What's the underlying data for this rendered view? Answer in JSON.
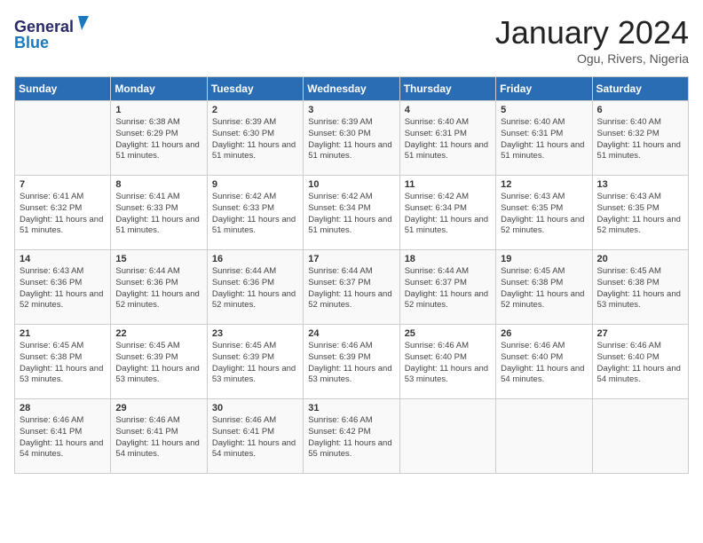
{
  "header": {
    "logo_line1": "General",
    "logo_line2": "Blue",
    "month_title": "January 2024",
    "location": "Ogu, Rivers, Nigeria"
  },
  "days_of_week": [
    "Sunday",
    "Monday",
    "Tuesday",
    "Wednesday",
    "Thursday",
    "Friday",
    "Saturday"
  ],
  "weeks": [
    [
      {
        "day": "",
        "sunrise": "",
        "sunset": "",
        "daylight": ""
      },
      {
        "day": "1",
        "sunrise": "Sunrise: 6:38 AM",
        "sunset": "Sunset: 6:29 PM",
        "daylight": "Daylight: 11 hours and 51 minutes."
      },
      {
        "day": "2",
        "sunrise": "Sunrise: 6:39 AM",
        "sunset": "Sunset: 6:30 PM",
        "daylight": "Daylight: 11 hours and 51 minutes."
      },
      {
        "day": "3",
        "sunrise": "Sunrise: 6:39 AM",
        "sunset": "Sunset: 6:30 PM",
        "daylight": "Daylight: 11 hours and 51 minutes."
      },
      {
        "day": "4",
        "sunrise": "Sunrise: 6:40 AM",
        "sunset": "Sunset: 6:31 PM",
        "daylight": "Daylight: 11 hours and 51 minutes."
      },
      {
        "day": "5",
        "sunrise": "Sunrise: 6:40 AM",
        "sunset": "Sunset: 6:31 PM",
        "daylight": "Daylight: 11 hours and 51 minutes."
      },
      {
        "day": "6",
        "sunrise": "Sunrise: 6:40 AM",
        "sunset": "Sunset: 6:32 PM",
        "daylight": "Daylight: 11 hours and 51 minutes."
      }
    ],
    [
      {
        "day": "7",
        "sunrise": "Sunrise: 6:41 AM",
        "sunset": "Sunset: 6:32 PM",
        "daylight": "Daylight: 11 hours and 51 minutes."
      },
      {
        "day": "8",
        "sunrise": "Sunrise: 6:41 AM",
        "sunset": "Sunset: 6:33 PM",
        "daylight": "Daylight: 11 hours and 51 minutes."
      },
      {
        "day": "9",
        "sunrise": "Sunrise: 6:42 AM",
        "sunset": "Sunset: 6:33 PM",
        "daylight": "Daylight: 11 hours and 51 minutes."
      },
      {
        "day": "10",
        "sunrise": "Sunrise: 6:42 AM",
        "sunset": "Sunset: 6:34 PM",
        "daylight": "Daylight: 11 hours and 51 minutes."
      },
      {
        "day": "11",
        "sunrise": "Sunrise: 6:42 AM",
        "sunset": "Sunset: 6:34 PM",
        "daylight": "Daylight: 11 hours and 51 minutes."
      },
      {
        "day": "12",
        "sunrise": "Sunrise: 6:43 AM",
        "sunset": "Sunset: 6:35 PM",
        "daylight": "Daylight: 11 hours and 52 minutes."
      },
      {
        "day": "13",
        "sunrise": "Sunrise: 6:43 AM",
        "sunset": "Sunset: 6:35 PM",
        "daylight": "Daylight: 11 hours and 52 minutes."
      }
    ],
    [
      {
        "day": "14",
        "sunrise": "Sunrise: 6:43 AM",
        "sunset": "Sunset: 6:36 PM",
        "daylight": "Daylight: 11 hours and 52 minutes."
      },
      {
        "day": "15",
        "sunrise": "Sunrise: 6:44 AM",
        "sunset": "Sunset: 6:36 PM",
        "daylight": "Daylight: 11 hours and 52 minutes."
      },
      {
        "day": "16",
        "sunrise": "Sunrise: 6:44 AM",
        "sunset": "Sunset: 6:36 PM",
        "daylight": "Daylight: 11 hours and 52 minutes."
      },
      {
        "day": "17",
        "sunrise": "Sunrise: 6:44 AM",
        "sunset": "Sunset: 6:37 PM",
        "daylight": "Daylight: 11 hours and 52 minutes."
      },
      {
        "day": "18",
        "sunrise": "Sunrise: 6:44 AM",
        "sunset": "Sunset: 6:37 PM",
        "daylight": "Daylight: 11 hours and 52 minutes."
      },
      {
        "day": "19",
        "sunrise": "Sunrise: 6:45 AM",
        "sunset": "Sunset: 6:38 PM",
        "daylight": "Daylight: 11 hours and 52 minutes."
      },
      {
        "day": "20",
        "sunrise": "Sunrise: 6:45 AM",
        "sunset": "Sunset: 6:38 PM",
        "daylight": "Daylight: 11 hours and 53 minutes."
      }
    ],
    [
      {
        "day": "21",
        "sunrise": "Sunrise: 6:45 AM",
        "sunset": "Sunset: 6:38 PM",
        "daylight": "Daylight: 11 hours and 53 minutes."
      },
      {
        "day": "22",
        "sunrise": "Sunrise: 6:45 AM",
        "sunset": "Sunset: 6:39 PM",
        "daylight": "Daylight: 11 hours and 53 minutes."
      },
      {
        "day": "23",
        "sunrise": "Sunrise: 6:45 AM",
        "sunset": "Sunset: 6:39 PM",
        "daylight": "Daylight: 11 hours and 53 minutes."
      },
      {
        "day": "24",
        "sunrise": "Sunrise: 6:46 AM",
        "sunset": "Sunset: 6:39 PM",
        "daylight": "Daylight: 11 hours and 53 minutes."
      },
      {
        "day": "25",
        "sunrise": "Sunrise: 6:46 AM",
        "sunset": "Sunset: 6:40 PM",
        "daylight": "Daylight: 11 hours and 53 minutes."
      },
      {
        "day": "26",
        "sunrise": "Sunrise: 6:46 AM",
        "sunset": "Sunset: 6:40 PM",
        "daylight": "Daylight: 11 hours and 54 minutes."
      },
      {
        "day": "27",
        "sunrise": "Sunrise: 6:46 AM",
        "sunset": "Sunset: 6:40 PM",
        "daylight": "Daylight: 11 hours and 54 minutes."
      }
    ],
    [
      {
        "day": "28",
        "sunrise": "Sunrise: 6:46 AM",
        "sunset": "Sunset: 6:41 PM",
        "daylight": "Daylight: 11 hours and 54 minutes."
      },
      {
        "day": "29",
        "sunrise": "Sunrise: 6:46 AM",
        "sunset": "Sunset: 6:41 PM",
        "daylight": "Daylight: 11 hours and 54 minutes."
      },
      {
        "day": "30",
        "sunrise": "Sunrise: 6:46 AM",
        "sunset": "Sunset: 6:41 PM",
        "daylight": "Daylight: 11 hours and 54 minutes."
      },
      {
        "day": "31",
        "sunrise": "Sunrise: 6:46 AM",
        "sunset": "Sunset: 6:42 PM",
        "daylight": "Daylight: 11 hours and 55 minutes."
      },
      {
        "day": "",
        "sunrise": "",
        "sunset": "",
        "daylight": ""
      },
      {
        "day": "",
        "sunrise": "",
        "sunset": "",
        "daylight": ""
      },
      {
        "day": "",
        "sunrise": "",
        "sunset": "",
        "daylight": ""
      }
    ]
  ]
}
